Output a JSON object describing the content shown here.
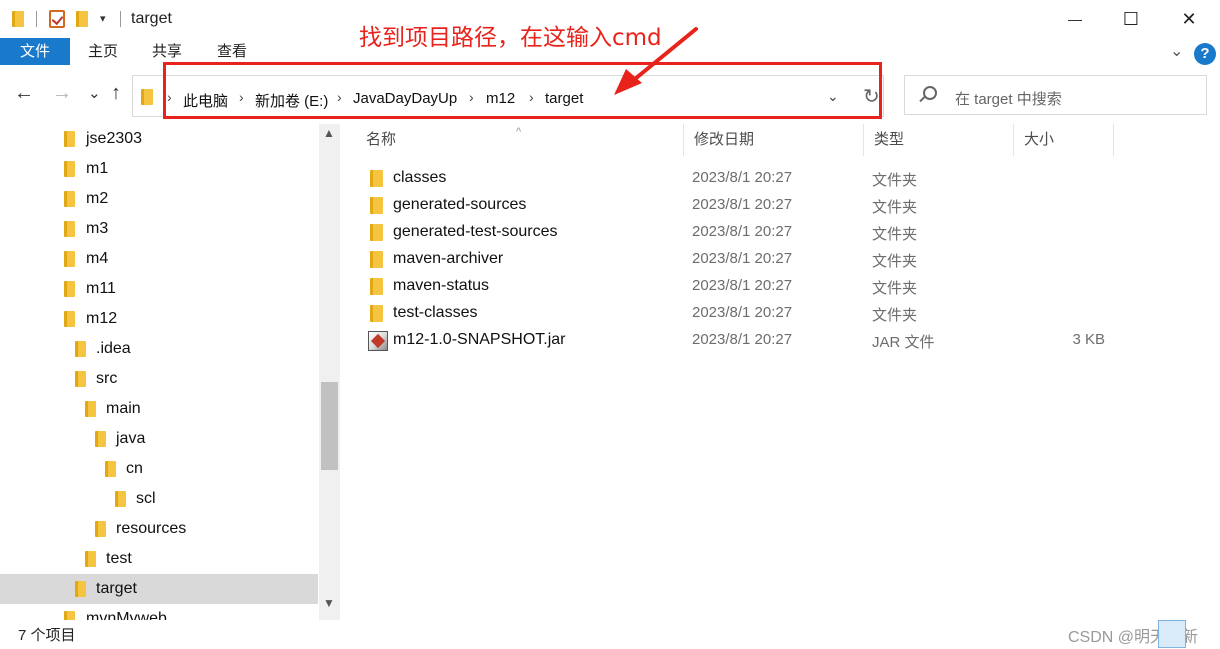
{
  "window": {
    "title": "target",
    "dropdown_glyph": "▾",
    "minimize_glyph": "—",
    "maximize_glyph": "☐",
    "close_glyph": "✕"
  },
  "ribbon": {
    "tabs": [
      {
        "label": "文件",
        "active": true
      },
      {
        "label": "主页",
        "active": false
      },
      {
        "label": "共享",
        "active": false
      },
      {
        "label": "查看",
        "active": false
      }
    ],
    "help_glyph": "?",
    "expand_glyph": "⌄"
  },
  "annotation": {
    "text": "找到项目路径，在这输入cmd",
    "color": "#e8231c"
  },
  "nav": {
    "back_glyph": "←",
    "forward_glyph": "→",
    "recent_glyph": "⌄",
    "up_glyph": "↑"
  },
  "address": {
    "crumbs": [
      "此电脑",
      "新加卷 (E:)",
      "JavaDayDayUp",
      "m12",
      "target"
    ],
    "separator": "›",
    "dropdown_glyph": "⌄",
    "refresh_glyph": "↻"
  },
  "search": {
    "placeholder": "在 target 中搜索",
    "icon": "search-icon"
  },
  "tree": {
    "items": [
      {
        "label": "jse2303",
        "selected": false
      },
      {
        "label": "m1",
        "selected": false
      },
      {
        "label": "m2",
        "selected": false
      },
      {
        "label": "m3",
        "selected": false
      },
      {
        "label": "m4",
        "selected": false
      },
      {
        "label": "m11",
        "selected": false
      },
      {
        "label": "m12",
        "selected": false
      },
      {
        "label": ".idea",
        "selected": false
      },
      {
        "label": "src",
        "selected": false
      },
      {
        "label": "main",
        "selected": false
      },
      {
        "label": "java",
        "selected": false
      },
      {
        "label": "cn",
        "selected": false
      },
      {
        "label": "scl",
        "selected": false
      },
      {
        "label": "resources",
        "selected": false
      },
      {
        "label": "test",
        "selected": false
      },
      {
        "label": "target",
        "selected": true
      },
      {
        "label": "mvnMyweb",
        "selected": false
      }
    ],
    "scroll_up_glyph": "▲",
    "scroll_down_glyph": "▼"
  },
  "files": {
    "columns": {
      "name": "名称",
      "date": "修改日期",
      "type": "类型",
      "size": "大小"
    },
    "sort_glyph": "^",
    "rows": [
      {
        "name": "classes",
        "date": "2023/8/1 20:27",
        "type": "文件夹",
        "size": "",
        "icon": "folder-icon"
      },
      {
        "name": "generated-sources",
        "date": "2023/8/1 20:27",
        "type": "文件夹",
        "size": "",
        "icon": "folder-icon"
      },
      {
        "name": "generated-test-sources",
        "date": "2023/8/1 20:27",
        "type": "文件夹",
        "size": "",
        "icon": "folder-icon"
      },
      {
        "name": "maven-archiver",
        "date": "2023/8/1 20:27",
        "type": "文件夹",
        "size": "",
        "icon": "folder-icon"
      },
      {
        "name": "maven-status",
        "date": "2023/8/1 20:27",
        "type": "文件夹",
        "size": "",
        "icon": "folder-icon"
      },
      {
        "name": "test-classes",
        "date": "2023/8/1 20:27",
        "type": "文件夹",
        "size": "",
        "icon": "folder-icon"
      },
      {
        "name": "m12-1.0-SNAPSHOT.jar",
        "date": "2023/8/1 20:27",
        "type": "JAR 文件",
        "size": "3 KB",
        "icon": "jar-file-icon"
      }
    ]
  },
  "status": {
    "count": "7 个项目",
    "watermark": "CSDN @明天更新"
  }
}
